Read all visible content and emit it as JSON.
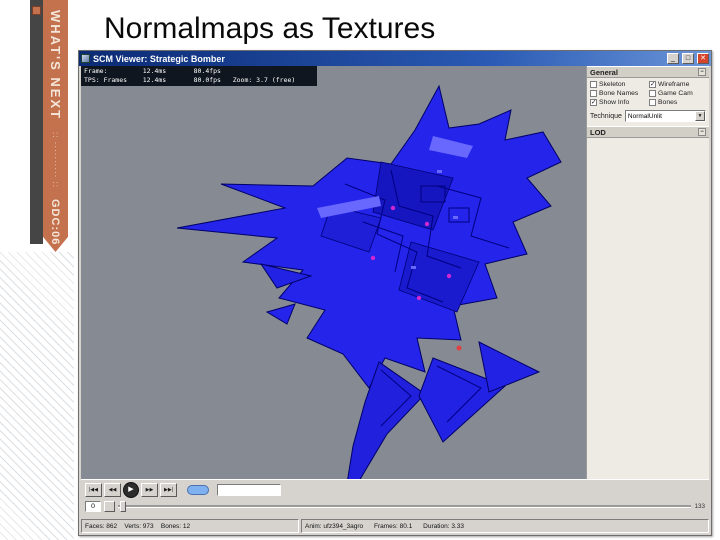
{
  "colors": {
    "accent_orange": "#c4724e",
    "model_blue": "#2424ea",
    "viewport_gray": "#868b93",
    "titlebar_blue": "#0b2a74",
    "close_red": "#d6442c"
  },
  "slide": {
    "title": "Normalmaps as Textures",
    "ribbon": {
      "brand": "WHAT'S NEXT",
      "dots": ":: ·········· ::",
      "event": "GDC:06"
    }
  },
  "viewer": {
    "title": "SCM Viewer: Strategic Bomber",
    "titlebar_buttons": {
      "minimize": "_",
      "maximize": "□",
      "close": "✕"
    },
    "stats_line1": "Frame:         12.4ms       80.4fps",
    "stats_line2": "TPS: Frames    12.4ms       80.0fps   Zoom: 3.7 (free)",
    "panel": {
      "general_header": "General",
      "general_collapse": "−",
      "checks_left": [
        {
          "label": "Skeleton",
          "mark": ""
        },
        {
          "label": "Bone Names",
          "mark": ""
        },
        {
          "label": "Show Info",
          "mark": "✓"
        }
      ],
      "checks_right": [
        {
          "label": "Wireframe",
          "mark": "✓"
        },
        {
          "label": "Game Cam",
          "mark": ""
        },
        {
          "label": "Bones",
          "mark": ""
        }
      ],
      "technique_label": "Technique",
      "technique_value": "NormalUnlit",
      "dropdown_arrow": "▼",
      "lod_header": "LOD",
      "lod_collapse": "−"
    },
    "transport": {
      "buttons": [
        {
          "name": "first",
          "glyph": "|◀◀"
        },
        {
          "name": "rewind",
          "glyph": "◀◀"
        },
        {
          "name": "play",
          "glyph": "▶"
        },
        {
          "name": "forward",
          "glyph": "▶▶"
        },
        {
          "name": "last",
          "glyph": "▶▶|"
        }
      ],
      "combo_value": ""
    },
    "timeline": {
      "frame_value": "0",
      "end_label": "133"
    },
    "status_left": "Faces: 862    Verts: 973    Bones: 12",
    "status_right": "Anim: ufz394_3agro      Frames: 80.1      Duration: 3.33"
  }
}
